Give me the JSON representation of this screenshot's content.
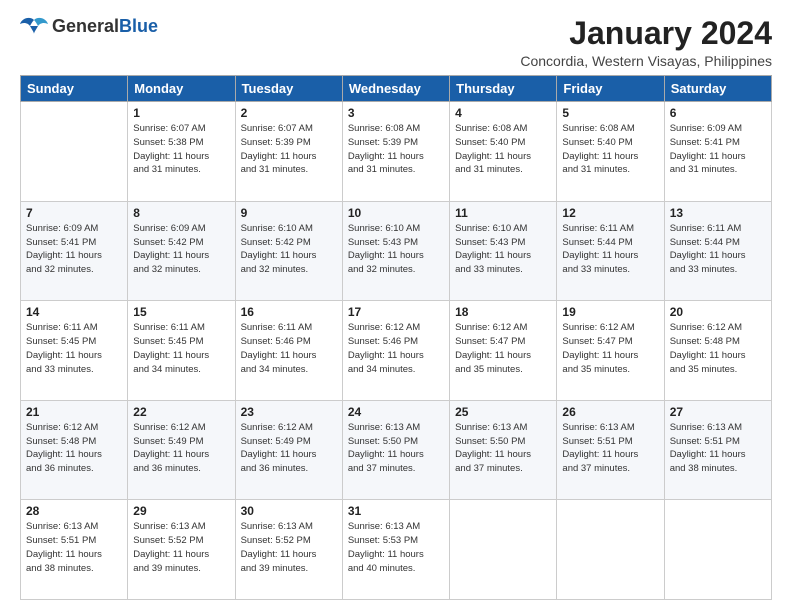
{
  "header": {
    "logo_general": "General",
    "logo_blue": "Blue",
    "month_title": "January 2024",
    "location": "Concordia, Western Visayas, Philippines"
  },
  "days_of_week": [
    "Sunday",
    "Monday",
    "Tuesday",
    "Wednesday",
    "Thursday",
    "Friday",
    "Saturday"
  ],
  "weeks": [
    [
      {
        "num": "",
        "info": ""
      },
      {
        "num": "1",
        "info": "Sunrise: 6:07 AM\nSunset: 5:38 PM\nDaylight: 11 hours\nand 31 minutes."
      },
      {
        "num": "2",
        "info": "Sunrise: 6:07 AM\nSunset: 5:39 PM\nDaylight: 11 hours\nand 31 minutes."
      },
      {
        "num": "3",
        "info": "Sunrise: 6:08 AM\nSunset: 5:39 PM\nDaylight: 11 hours\nand 31 minutes."
      },
      {
        "num": "4",
        "info": "Sunrise: 6:08 AM\nSunset: 5:40 PM\nDaylight: 11 hours\nand 31 minutes."
      },
      {
        "num": "5",
        "info": "Sunrise: 6:08 AM\nSunset: 5:40 PM\nDaylight: 11 hours\nand 31 minutes."
      },
      {
        "num": "6",
        "info": "Sunrise: 6:09 AM\nSunset: 5:41 PM\nDaylight: 11 hours\nand 31 minutes."
      }
    ],
    [
      {
        "num": "7",
        "info": "Sunrise: 6:09 AM\nSunset: 5:41 PM\nDaylight: 11 hours\nand 32 minutes."
      },
      {
        "num": "8",
        "info": "Sunrise: 6:09 AM\nSunset: 5:42 PM\nDaylight: 11 hours\nand 32 minutes."
      },
      {
        "num": "9",
        "info": "Sunrise: 6:10 AM\nSunset: 5:42 PM\nDaylight: 11 hours\nand 32 minutes."
      },
      {
        "num": "10",
        "info": "Sunrise: 6:10 AM\nSunset: 5:43 PM\nDaylight: 11 hours\nand 32 minutes."
      },
      {
        "num": "11",
        "info": "Sunrise: 6:10 AM\nSunset: 5:43 PM\nDaylight: 11 hours\nand 33 minutes."
      },
      {
        "num": "12",
        "info": "Sunrise: 6:11 AM\nSunset: 5:44 PM\nDaylight: 11 hours\nand 33 minutes."
      },
      {
        "num": "13",
        "info": "Sunrise: 6:11 AM\nSunset: 5:44 PM\nDaylight: 11 hours\nand 33 minutes."
      }
    ],
    [
      {
        "num": "14",
        "info": "Sunrise: 6:11 AM\nSunset: 5:45 PM\nDaylight: 11 hours\nand 33 minutes."
      },
      {
        "num": "15",
        "info": "Sunrise: 6:11 AM\nSunset: 5:45 PM\nDaylight: 11 hours\nand 34 minutes."
      },
      {
        "num": "16",
        "info": "Sunrise: 6:11 AM\nSunset: 5:46 PM\nDaylight: 11 hours\nand 34 minutes."
      },
      {
        "num": "17",
        "info": "Sunrise: 6:12 AM\nSunset: 5:46 PM\nDaylight: 11 hours\nand 34 minutes."
      },
      {
        "num": "18",
        "info": "Sunrise: 6:12 AM\nSunset: 5:47 PM\nDaylight: 11 hours\nand 35 minutes."
      },
      {
        "num": "19",
        "info": "Sunrise: 6:12 AM\nSunset: 5:47 PM\nDaylight: 11 hours\nand 35 minutes."
      },
      {
        "num": "20",
        "info": "Sunrise: 6:12 AM\nSunset: 5:48 PM\nDaylight: 11 hours\nand 35 minutes."
      }
    ],
    [
      {
        "num": "21",
        "info": "Sunrise: 6:12 AM\nSunset: 5:48 PM\nDaylight: 11 hours\nand 36 minutes."
      },
      {
        "num": "22",
        "info": "Sunrise: 6:12 AM\nSunset: 5:49 PM\nDaylight: 11 hours\nand 36 minutes."
      },
      {
        "num": "23",
        "info": "Sunrise: 6:12 AM\nSunset: 5:49 PM\nDaylight: 11 hours\nand 36 minutes."
      },
      {
        "num": "24",
        "info": "Sunrise: 6:13 AM\nSunset: 5:50 PM\nDaylight: 11 hours\nand 37 minutes."
      },
      {
        "num": "25",
        "info": "Sunrise: 6:13 AM\nSunset: 5:50 PM\nDaylight: 11 hours\nand 37 minutes."
      },
      {
        "num": "26",
        "info": "Sunrise: 6:13 AM\nSunset: 5:51 PM\nDaylight: 11 hours\nand 37 minutes."
      },
      {
        "num": "27",
        "info": "Sunrise: 6:13 AM\nSunset: 5:51 PM\nDaylight: 11 hours\nand 38 minutes."
      }
    ],
    [
      {
        "num": "28",
        "info": "Sunrise: 6:13 AM\nSunset: 5:51 PM\nDaylight: 11 hours\nand 38 minutes."
      },
      {
        "num": "29",
        "info": "Sunrise: 6:13 AM\nSunset: 5:52 PM\nDaylight: 11 hours\nand 39 minutes."
      },
      {
        "num": "30",
        "info": "Sunrise: 6:13 AM\nSunset: 5:52 PM\nDaylight: 11 hours\nand 39 minutes."
      },
      {
        "num": "31",
        "info": "Sunrise: 6:13 AM\nSunset: 5:53 PM\nDaylight: 11 hours\nand 40 minutes."
      },
      {
        "num": "",
        "info": ""
      },
      {
        "num": "",
        "info": ""
      },
      {
        "num": "",
        "info": ""
      }
    ]
  ]
}
